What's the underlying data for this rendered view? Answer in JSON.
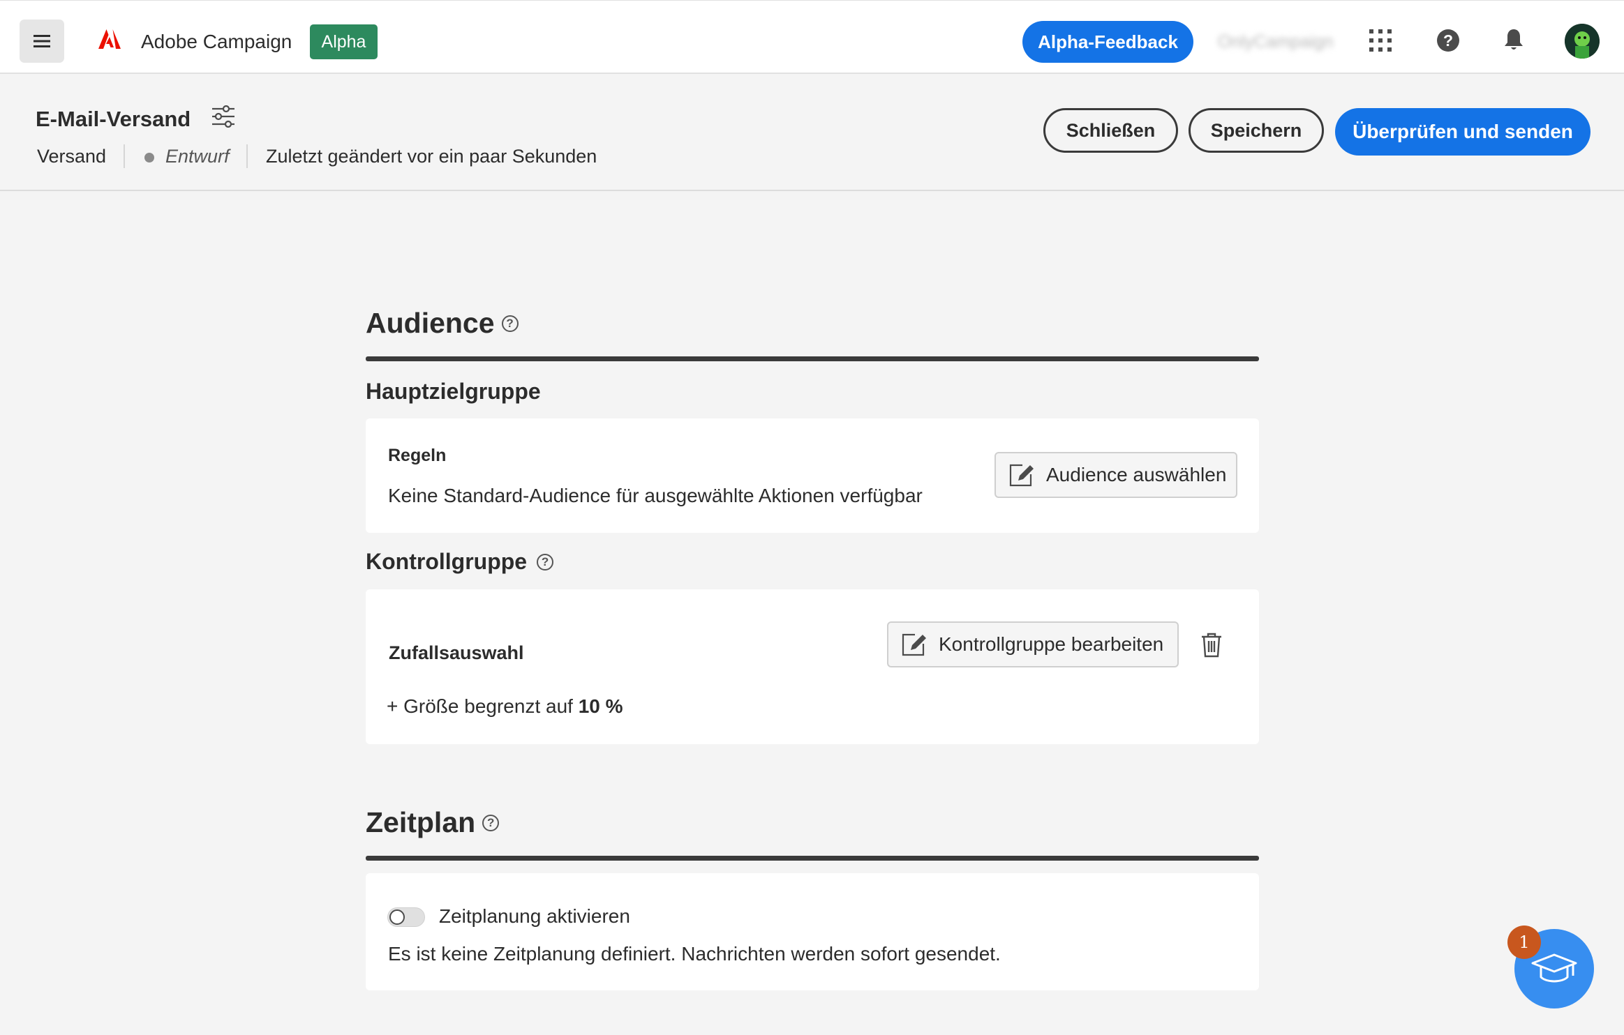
{
  "topbar": {
    "app_title": "Adobe Campaign",
    "alpha_badge": "Alpha",
    "feedback_label": "Alpha-Feedback",
    "org_name": "OnlyCampaign",
    "icons": [
      "menu-icon",
      "adobe-logo-icon",
      "apps-grid-icon",
      "help-icon",
      "bell-icon",
      "avatar"
    ]
  },
  "header": {
    "title": "E-Mail-Versand",
    "type": "Versand",
    "status": "Entwurf",
    "modified": "Zuletzt geändert vor ein paar Sekunden",
    "close_label": "Schließen",
    "save_label": "Speichern",
    "review_label": "Überprüfen und senden"
  },
  "audience": {
    "title": "Audience",
    "main_target_title": "Hauptzielgruppe",
    "rules_label": "Regeln",
    "rules_text": "Keine Standard-Audience für ausgewählte Aktionen verfügbar",
    "select_button": "Audience auswählen",
    "control_group_title": "Kontrollgruppe",
    "random_label": "Zufallsauswahl",
    "size_prefix": "+ Größe begrenzt auf",
    "size_value": "10 %",
    "edit_control_button": "Kontrollgruppe bearbeiten"
  },
  "schedule": {
    "title": "Zeitplan",
    "toggle_label": "Zeitplanung aktivieren",
    "toggle_on": false,
    "info_text": "Es ist keine Zeitplanung definiert. Nachrichten werden sofort gesendet."
  },
  "learn_fab": {
    "badge_count": "1"
  },
  "colors": {
    "accent": "#1473e6",
    "alpha_badge": "#2d8a5e",
    "badge": "#c8571e",
    "adobe_red": "#eb1000"
  }
}
